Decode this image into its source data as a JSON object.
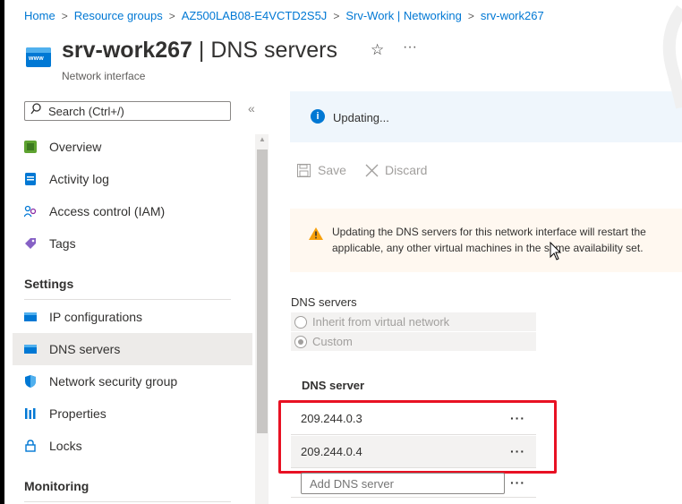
{
  "breadcrumb": [
    "Home",
    "Resource groups",
    "AZ500LAB08-E4VCTD2S5J",
    "Srv-Work | Networking",
    "srv-work267"
  ],
  "header": {
    "resource_name": "srv-work267",
    "title_suffix": " | DNS servers",
    "subtitle": "Network interface",
    "icon_text": "www",
    "star": "☆",
    "more": "···"
  },
  "sidebar": {
    "search_placeholder": "Search (Ctrl+/)",
    "collapse": "«",
    "items_top": [
      {
        "label": "Overview",
        "icon": "overview-icon"
      },
      {
        "label": "Activity log",
        "icon": "activity-log-icon"
      },
      {
        "label": "Access control (IAM)",
        "icon": "iam-icon"
      },
      {
        "label": "Tags",
        "icon": "tag-icon"
      }
    ],
    "settings_title": "Settings",
    "items_settings": [
      {
        "label": "IP configurations",
        "icon": "ip-config-icon"
      },
      {
        "label": "DNS servers",
        "icon": "dns-servers-icon",
        "active": true
      },
      {
        "label": "Network security group",
        "icon": "shield-icon"
      },
      {
        "label": "Properties",
        "icon": "properties-icon"
      },
      {
        "label": "Locks",
        "icon": "lock-icon"
      }
    ],
    "monitoring_title": "Monitoring"
  },
  "main": {
    "info_banner": "Updating...",
    "toolbar": {
      "save": "Save",
      "discard": "Discard"
    },
    "warning": {
      "line1": "Updating the DNS servers for this network interface will restart the",
      "line2a": "applicable, any other virtual machines in ",
      "line2b": "the same availability set."
    },
    "dns_servers_label": "DNS servers",
    "radio_options": [
      {
        "label": "Inherit from virtual network",
        "checked": false
      },
      {
        "label": "Custom",
        "checked": true
      }
    ],
    "column_header": "DNS server",
    "dns_entries": [
      "209.244.0.3",
      "209.244.0.4"
    ],
    "row_menu": "···",
    "add_placeholder": "Add DNS server"
  },
  "colors": {
    "accent": "#0078d4",
    "highlight": "#e81123",
    "warning": "#f7a00b"
  }
}
